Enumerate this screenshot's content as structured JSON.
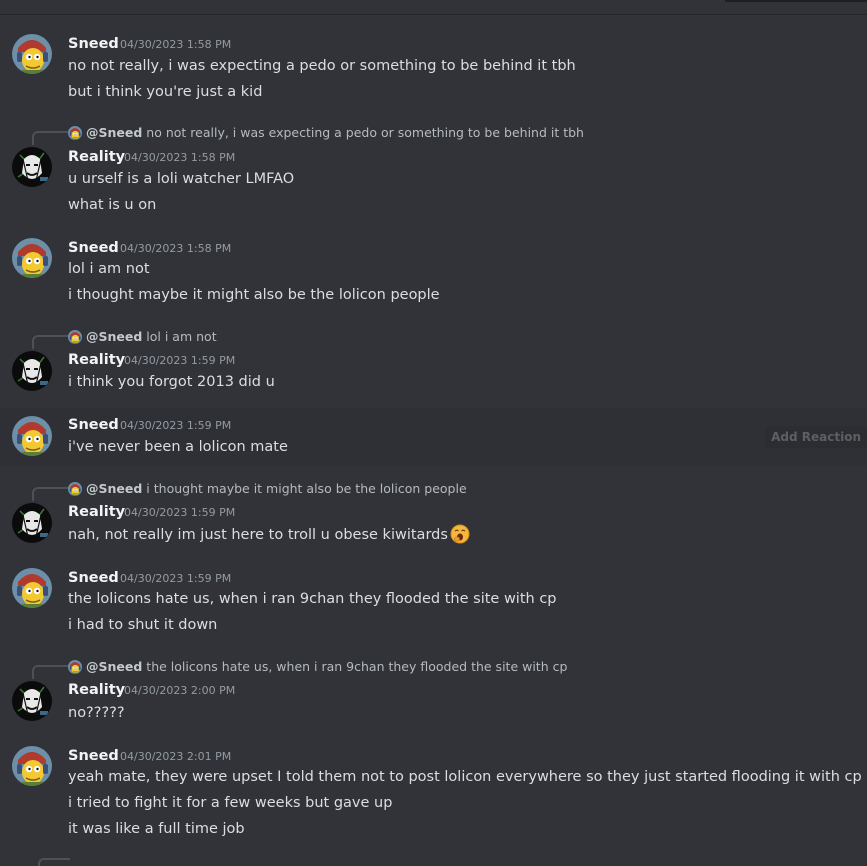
{
  "chat": {
    "messages": [
      {
        "author": "Sneed",
        "time": "04/30/2023 1:58 PM",
        "lines": [
          "no not really, i was expecting a pedo or something to be behind it tbh",
          "but i think you're just a kid"
        ]
      },
      {
        "reply": {
          "mention": "@Sneed",
          "text": "no not really, i was expecting a pedo or something to be behind it tbh"
        },
        "author": "Reality",
        "time": "04/30/2023 1:58 PM",
        "lines": [
          "u urself is a loli watcher LMFAO",
          "what is u on"
        ]
      },
      {
        "author": "Sneed",
        "time": "04/30/2023 1:58 PM",
        "lines": [
          "lol i am not",
          "i thought maybe it might also be the lolicon people"
        ]
      },
      {
        "reply": {
          "mention": "@Sneed",
          "text": "lol i am not"
        },
        "author": "Reality",
        "time": "04/30/2023 1:59 PM",
        "lines": [
          "i think you forgot 2013 did u"
        ]
      },
      {
        "author": "Sneed",
        "time": "04/30/2023 1:59 PM",
        "lines": [
          "i've never been a lolicon mate"
        ],
        "hover_action": "Add Reaction"
      },
      {
        "reply": {
          "mention": "@Sneed",
          "text": "i thought maybe it might also be the lolicon people"
        },
        "author": "Reality",
        "time": "04/30/2023 1:59 PM",
        "lines": [
          "nah, not really im just here to troll u obese kiwitards"
        ],
        "emoji": "yawning-face-icon"
      },
      {
        "author": "Sneed",
        "time": "04/30/2023 1:59 PM",
        "lines": [
          "the lolicons hate us, when i ran 9chan they flooded the site with cp",
          "i had to shut it down"
        ]
      },
      {
        "reply": {
          "mention": "@Sneed",
          "text": "the lolicons hate us, when i ran 9chan they flooded the site with cp"
        },
        "author": "Reality",
        "time": "04/30/2023 2:00 PM",
        "lines": [
          "no?????"
        ]
      },
      {
        "author": "Sneed",
        "time": "04/30/2023 2:01 PM",
        "lines": [
          "yeah mate, they were upset I told them not to post lolicon everywhere so they just started flooding it with cp",
          "i tried to fight it for a few weeks but gave up",
          "it was like a full time job"
        ]
      }
    ]
  },
  "colors": {
    "background": "#313338",
    "hover": "#2e3035",
    "name": "#f2f3f5",
    "text": "#dbdee1",
    "timestamp": "#949ba4"
  }
}
